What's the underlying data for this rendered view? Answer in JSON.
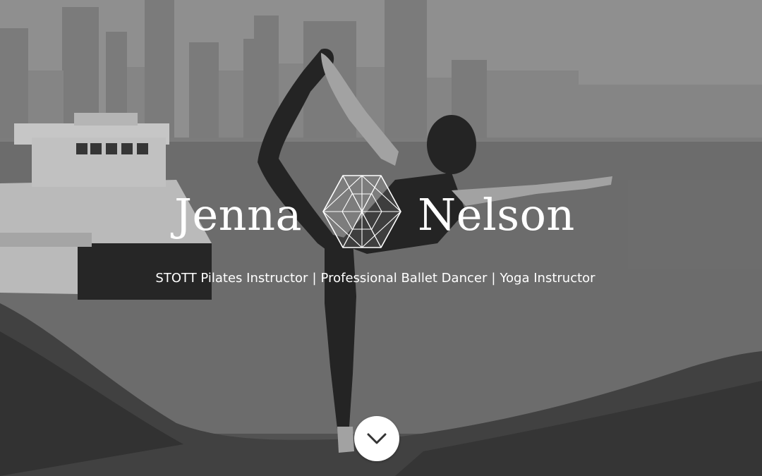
{
  "hero": {
    "name_first": "Jenna",
    "name_last": "Nelson",
    "logo_icon": "geometric-hexagon-logo",
    "subtitle": {
      "parts": [
        "STOTT Pilates Instructor",
        "Professional Ballet Dancer",
        "Yoga Instructor"
      ],
      "separator": "|"
    },
    "scroll_button_icon": "chevron-down-icon"
  },
  "colors": {
    "text": "#ffffff",
    "button_bg": "#ffffff",
    "button_icon": "#333333"
  }
}
